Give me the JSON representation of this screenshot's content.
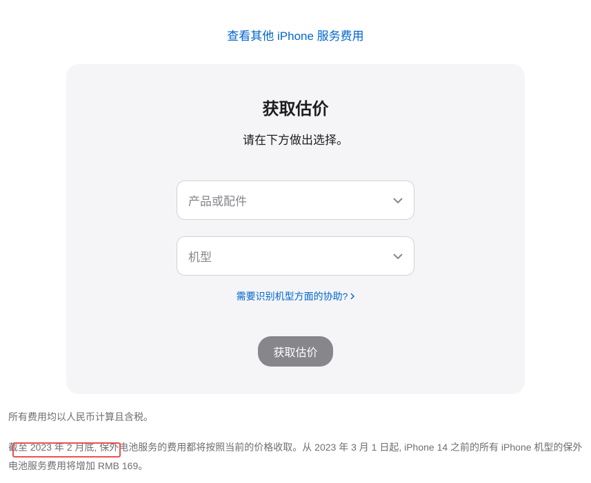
{
  "topLink": {
    "label": "查看其他 iPhone 服务费用"
  },
  "card": {
    "title": "获取估价",
    "subtitle": "请在下方做出选择。",
    "select1": {
      "placeholder": "产品或配件"
    },
    "select2": {
      "placeholder": "机型"
    },
    "helpLink": {
      "label": "需要识别机型方面的协助?"
    },
    "submitButton": {
      "label": "获取估价"
    }
  },
  "footer": {
    "line1": "所有费用均以人民币计算且含税。",
    "line2": "截至 2023 年 2 月底, 保外电池服务的费用都将按照当前的价格收取。从 2023 年 3 月 1 日起, iPhone 14 之前的所有 iPhone 机型的保外电池服务费用将增加 RMB 169。"
  }
}
